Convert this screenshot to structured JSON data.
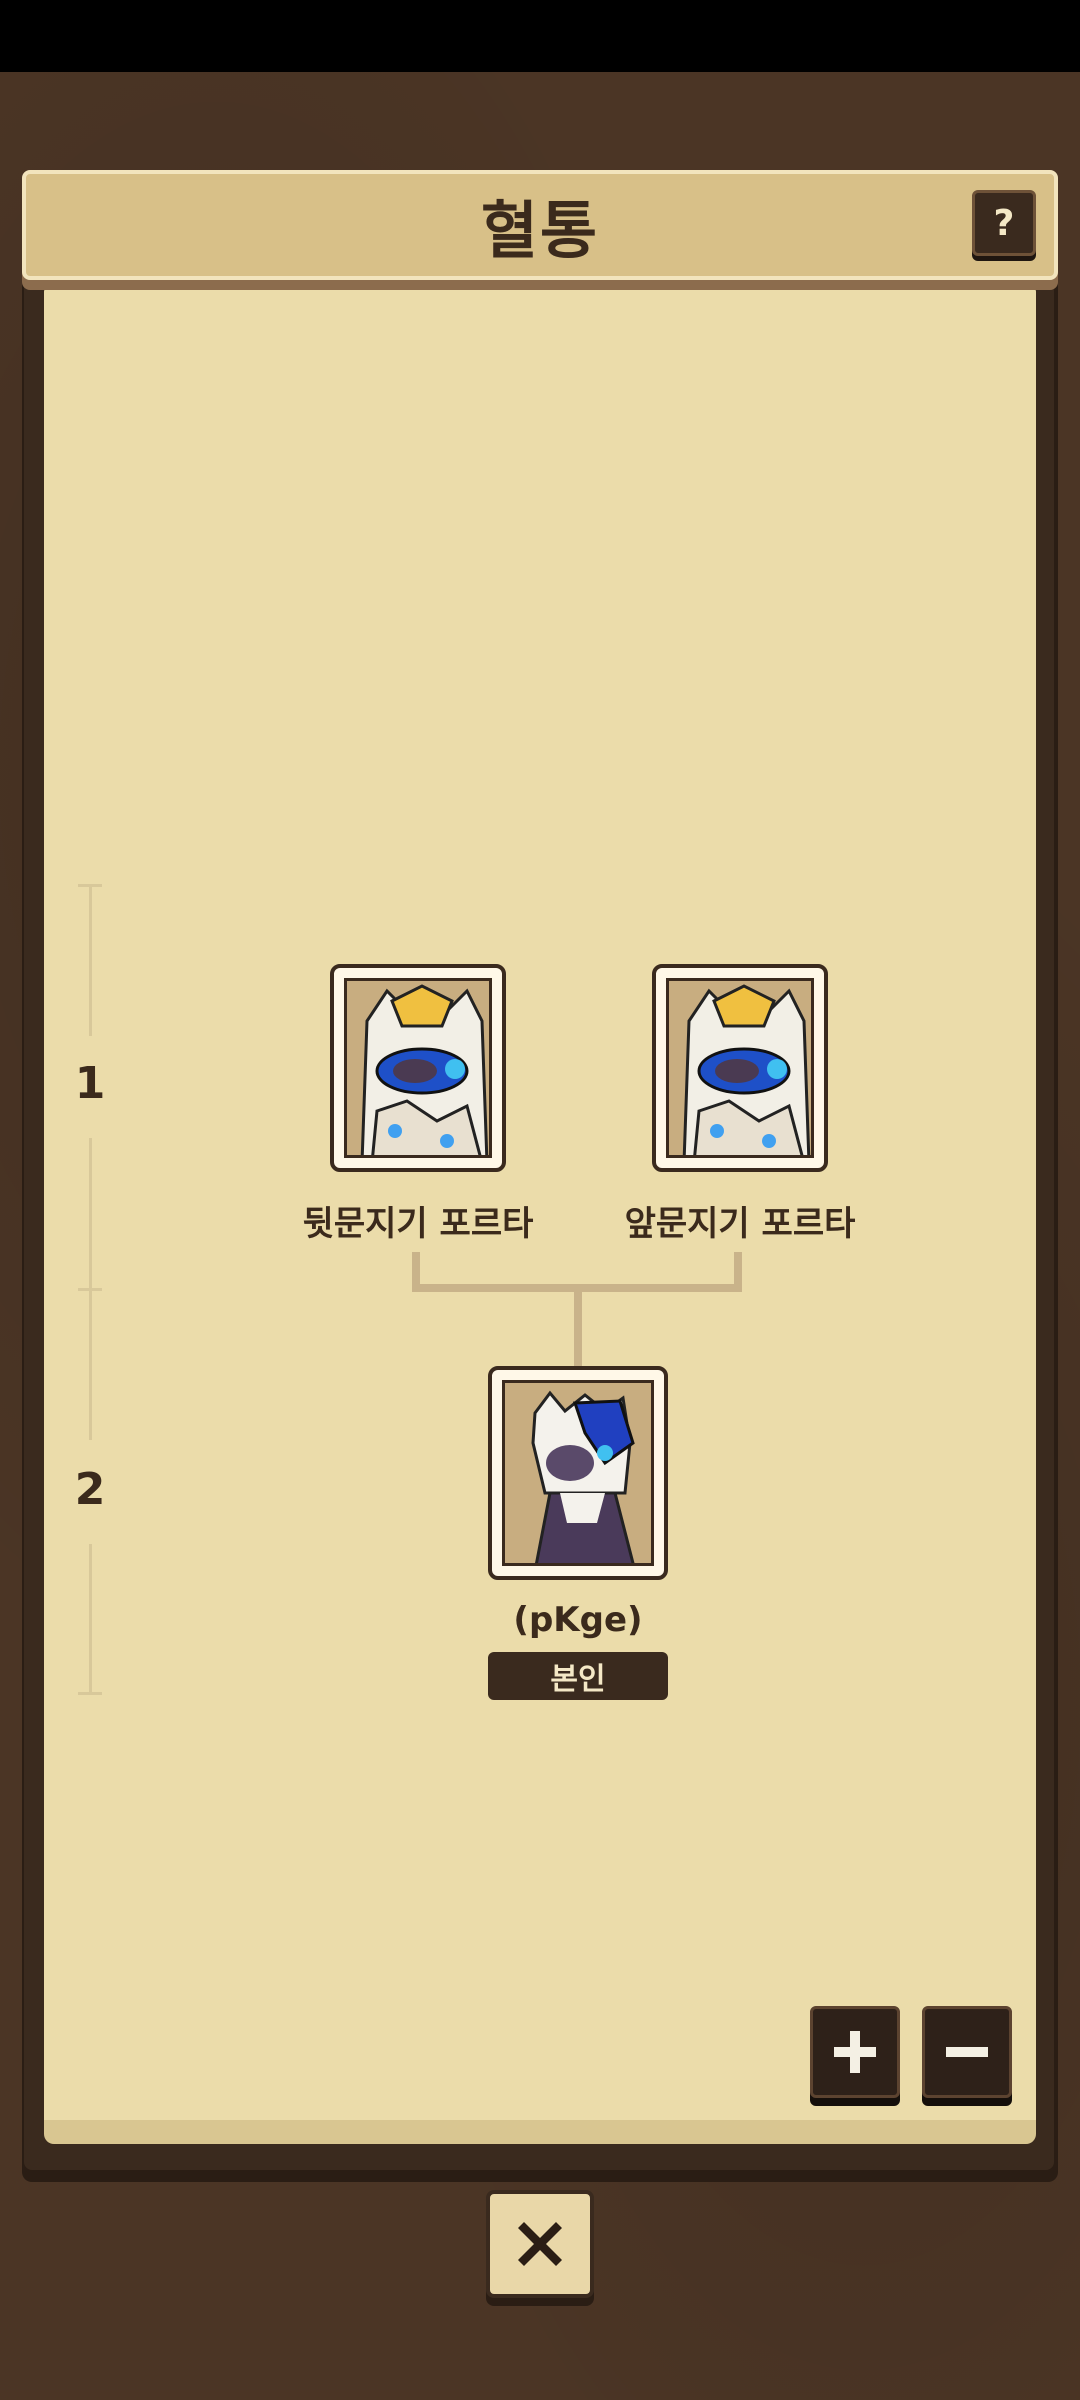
{
  "title": "혈통",
  "help_label": "?",
  "generations": [
    "1",
    "2"
  ],
  "parents": [
    {
      "name": "뒷문지기 포르타"
    },
    {
      "name": "앞문지기 포르타"
    }
  ],
  "self": {
    "name": "(pKge)",
    "badge": "본인"
  },
  "icons": {
    "help": "question-icon",
    "zoom_in": "plus-icon",
    "zoom_out": "minus-icon",
    "close": "close-icon"
  },
  "colors": {
    "paper": "#ebdcaa",
    "frame": "#3a2a1e",
    "title_bar": "#d8c088"
  }
}
